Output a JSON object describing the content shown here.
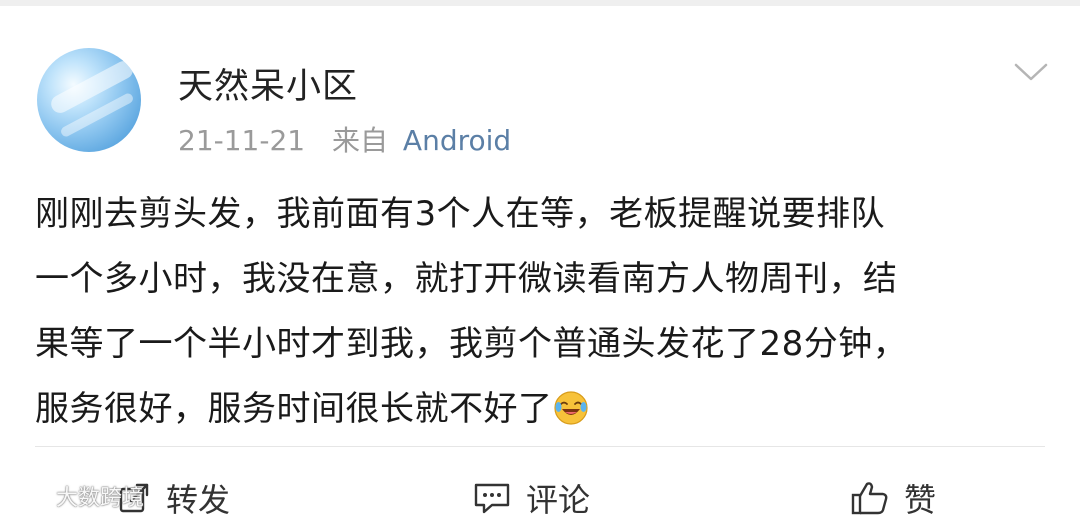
{
  "post": {
    "username": "天然呆小区",
    "date": "21-11-21",
    "from_label": "来自",
    "source": "Android",
    "text_lines": [
      "刚刚去剪头发，我前面有3个人在等，老板提醒说要排队",
      "一个多小时，我没在意，就打开微读看南方人物周刊，结",
      "果等了一个半小时才到我，我剪个普通头发花了28分钟，",
      "服务很好，服务时间很长就不好了"
    ],
    "emoji": "laugh-cry-emoji"
  },
  "actions": {
    "repost": "转发",
    "comment": "评论",
    "like": "赞"
  },
  "watermark": {
    "text": "大数跨境"
  }
}
